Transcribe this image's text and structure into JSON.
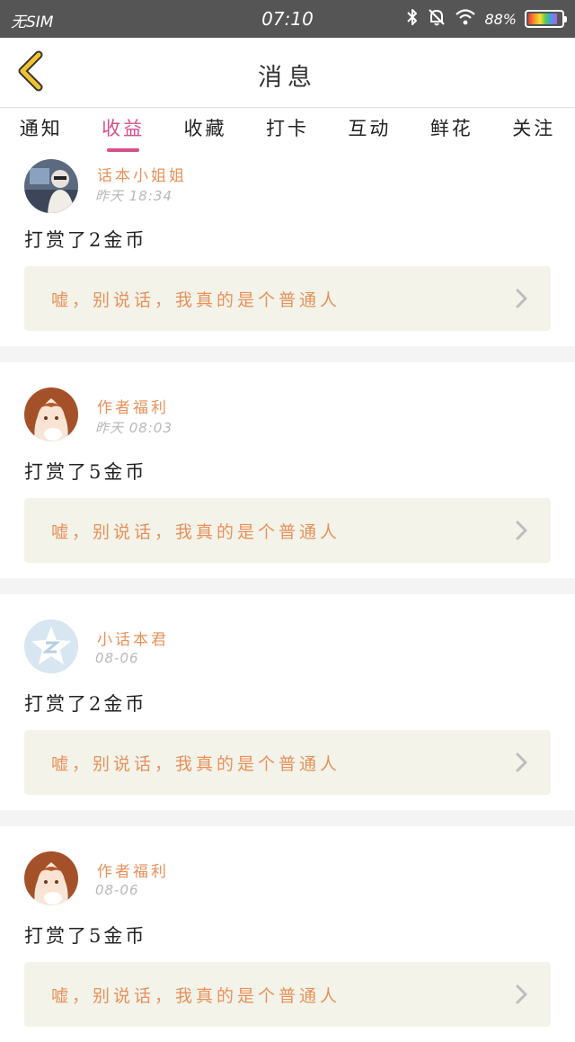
{
  "status_bar": {
    "carrier": "无SIM",
    "time": "07:10",
    "battery_percent": "88%",
    "battery_level": 0.88,
    "icons": [
      "bluetooth-icon",
      "bell-muted-icon",
      "wifi-icon",
      "battery-icon"
    ]
  },
  "header": {
    "title": "消息",
    "back_icon": "chevron-left-icon",
    "accent": "#f2c230"
  },
  "tabs": [
    {
      "label": "通知",
      "active": false
    },
    {
      "label": "收益",
      "active": true
    },
    {
      "label": "收藏",
      "active": false
    },
    {
      "label": "打卡",
      "active": false
    },
    {
      "label": "互动",
      "active": false
    },
    {
      "label": "鲜花",
      "active": false
    },
    {
      "label": "关注",
      "active": false
    }
  ],
  "colors": {
    "active_tab": "#d64f8c",
    "username": "#e8915a",
    "quote_bg": "#f3f3ea"
  },
  "messages": [
    {
      "username": "话本小姐姐",
      "time": "昨天 18:34",
      "text": "打赏了2金币",
      "quote": "嘘，别说话，我真的是个普通人",
      "avatar": "photo-avatar"
    },
    {
      "username": "作者福利",
      "time": "昨天 08:03",
      "text": "打赏了5金币",
      "quote": "嘘，别说话，我真的是个普通人",
      "avatar": "anime-girl-avatar"
    },
    {
      "username": "小话本君",
      "time": "08-06",
      "text": "打赏了2金币",
      "quote": "嘘，别说话，我真的是个普通人",
      "avatar": "default-star-avatar"
    },
    {
      "username": "作者福利",
      "time": "08-06",
      "text": "打赏了5金币",
      "quote": "嘘，别说话，我真的是个普通人",
      "avatar": "anime-girl-avatar"
    }
  ]
}
